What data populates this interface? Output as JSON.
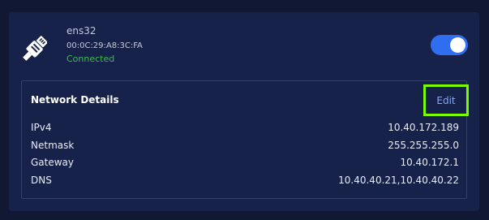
{
  "interface": {
    "icon": "ethernet-plug-icon",
    "name": "ens32",
    "mac": "00:0C:29:A8:3C:FA",
    "status": "Connected",
    "status_color": "#3fb950",
    "enabled": true,
    "toggle_color": "#2f6ef0"
  },
  "details": {
    "title": "Network Details",
    "edit_label": "Edit",
    "edit_highlight_color": "#7cfc00",
    "rows": [
      {
        "label": "IPv4",
        "value": "10.40.172.189"
      },
      {
        "label": "Netmask",
        "value": "255.255.255.0"
      },
      {
        "label": "Gateway",
        "value": "10.40.172.1"
      },
      {
        "label": "DNS",
        "value": "10.40.40.21,10.40.40.22"
      }
    ]
  }
}
